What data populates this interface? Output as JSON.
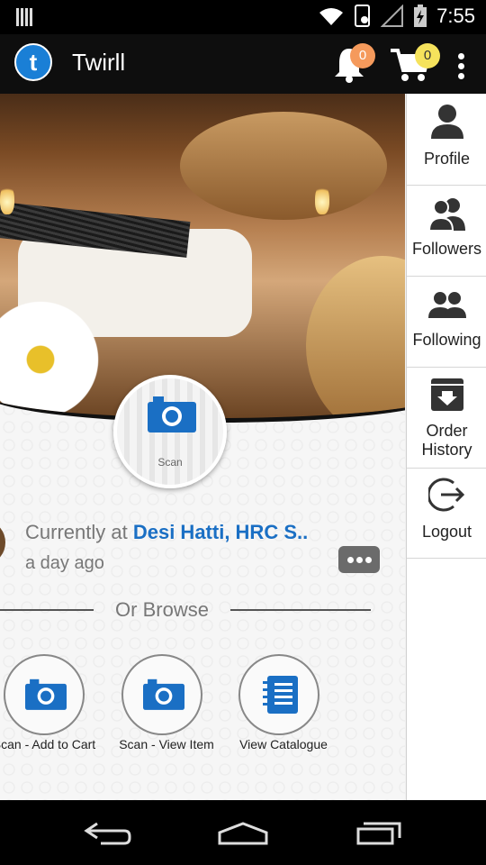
{
  "status_bar": {
    "time": "7:55"
  },
  "app_bar": {
    "title": "Twirll",
    "notification_count": "0",
    "cart_count": "0"
  },
  "scan": {
    "label": "Scan"
  },
  "location": {
    "prefix": "Currently at",
    "place": "Desi Hatti, HRC S..",
    "time_ago": "a day ago"
  },
  "browse": {
    "heading": "Or Browse",
    "actions": [
      {
        "label": "Scan - Add to Cart",
        "icon": "camera-icon"
      },
      {
        "label": "Scan - View Item",
        "icon": "camera-icon"
      },
      {
        "label": "View Catalogue",
        "icon": "notebook-icon"
      }
    ]
  },
  "side_menu": [
    {
      "label": "Profile",
      "icon": "person-icon"
    },
    {
      "label": "Followers",
      "icon": "followers-icon"
    },
    {
      "label": "Following",
      "icon": "following-icon"
    },
    {
      "label": "Order History",
      "icon": "archive-download-icon"
    },
    {
      "label": "Logout",
      "icon": "logout-icon"
    }
  ],
  "colors": {
    "accent": "#1a6fc4",
    "notification_badge": "#f59a5c",
    "cart_badge": "#f5e25c",
    "app_bar": "#0e0e0e"
  }
}
